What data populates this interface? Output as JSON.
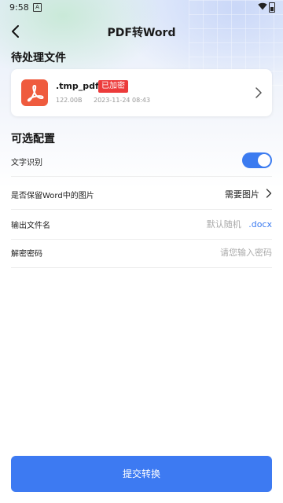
{
  "status_bar": {
    "time": "9:58",
    "notification_letter": "A"
  },
  "nav": {
    "title": "PDF转Word"
  },
  "pending_section": {
    "title": "待处理文件"
  },
  "file": {
    "name": ".tmp_pdf",
    "badge": "已加密",
    "size": "122.00B",
    "date": "2023-11-24 08:43"
  },
  "options_section": {
    "title": "可选配置"
  },
  "options": {
    "ocr_label": "文字识别",
    "ocr_enabled": true,
    "keep_images_label": "是否保留Word中的图片",
    "keep_images_value": "需要图片",
    "output_name_label": "输出文件名",
    "output_name_placeholder": "默认随机",
    "output_ext": ".docx",
    "password_label": "解密密码",
    "password_placeholder": "请您输入密码"
  },
  "submit": {
    "label": "提交转换"
  },
  "colors": {
    "accent": "#3d7af2",
    "badge": "#ec3b3b",
    "pdf_icon": "#ef5b3e"
  }
}
